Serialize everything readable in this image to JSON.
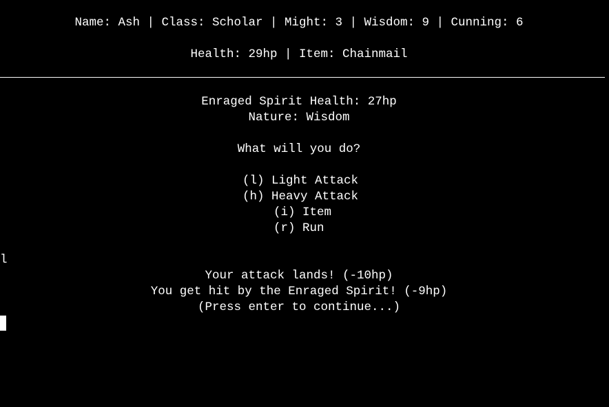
{
  "colors": {
    "background": "#000000",
    "text": "#ffffff"
  },
  "status": {
    "stats_line": "Name: Ash | Class: Scholar | Might: 3 | Wisdom: 9 | Cunning: 6",
    "health_line": "Health: 29hp | Item: Chainmail"
  },
  "enemy": {
    "health_line": "Enraged Spirit Health: 27hp",
    "nature_line": "Nature: Wisdom"
  },
  "prompt": "What will you do?",
  "menu": {
    "options": [
      "(l) Light Attack",
      "(h) Heavy Attack",
      "(i) Item",
      "(r) Run"
    ]
  },
  "input_echo": "l",
  "log": {
    "lines": [
      "Your attack lands! (-10hp)",
      "You get hit by the Enraged Spirit! (-9hp)",
      "(Press enter to continue...)"
    ]
  }
}
